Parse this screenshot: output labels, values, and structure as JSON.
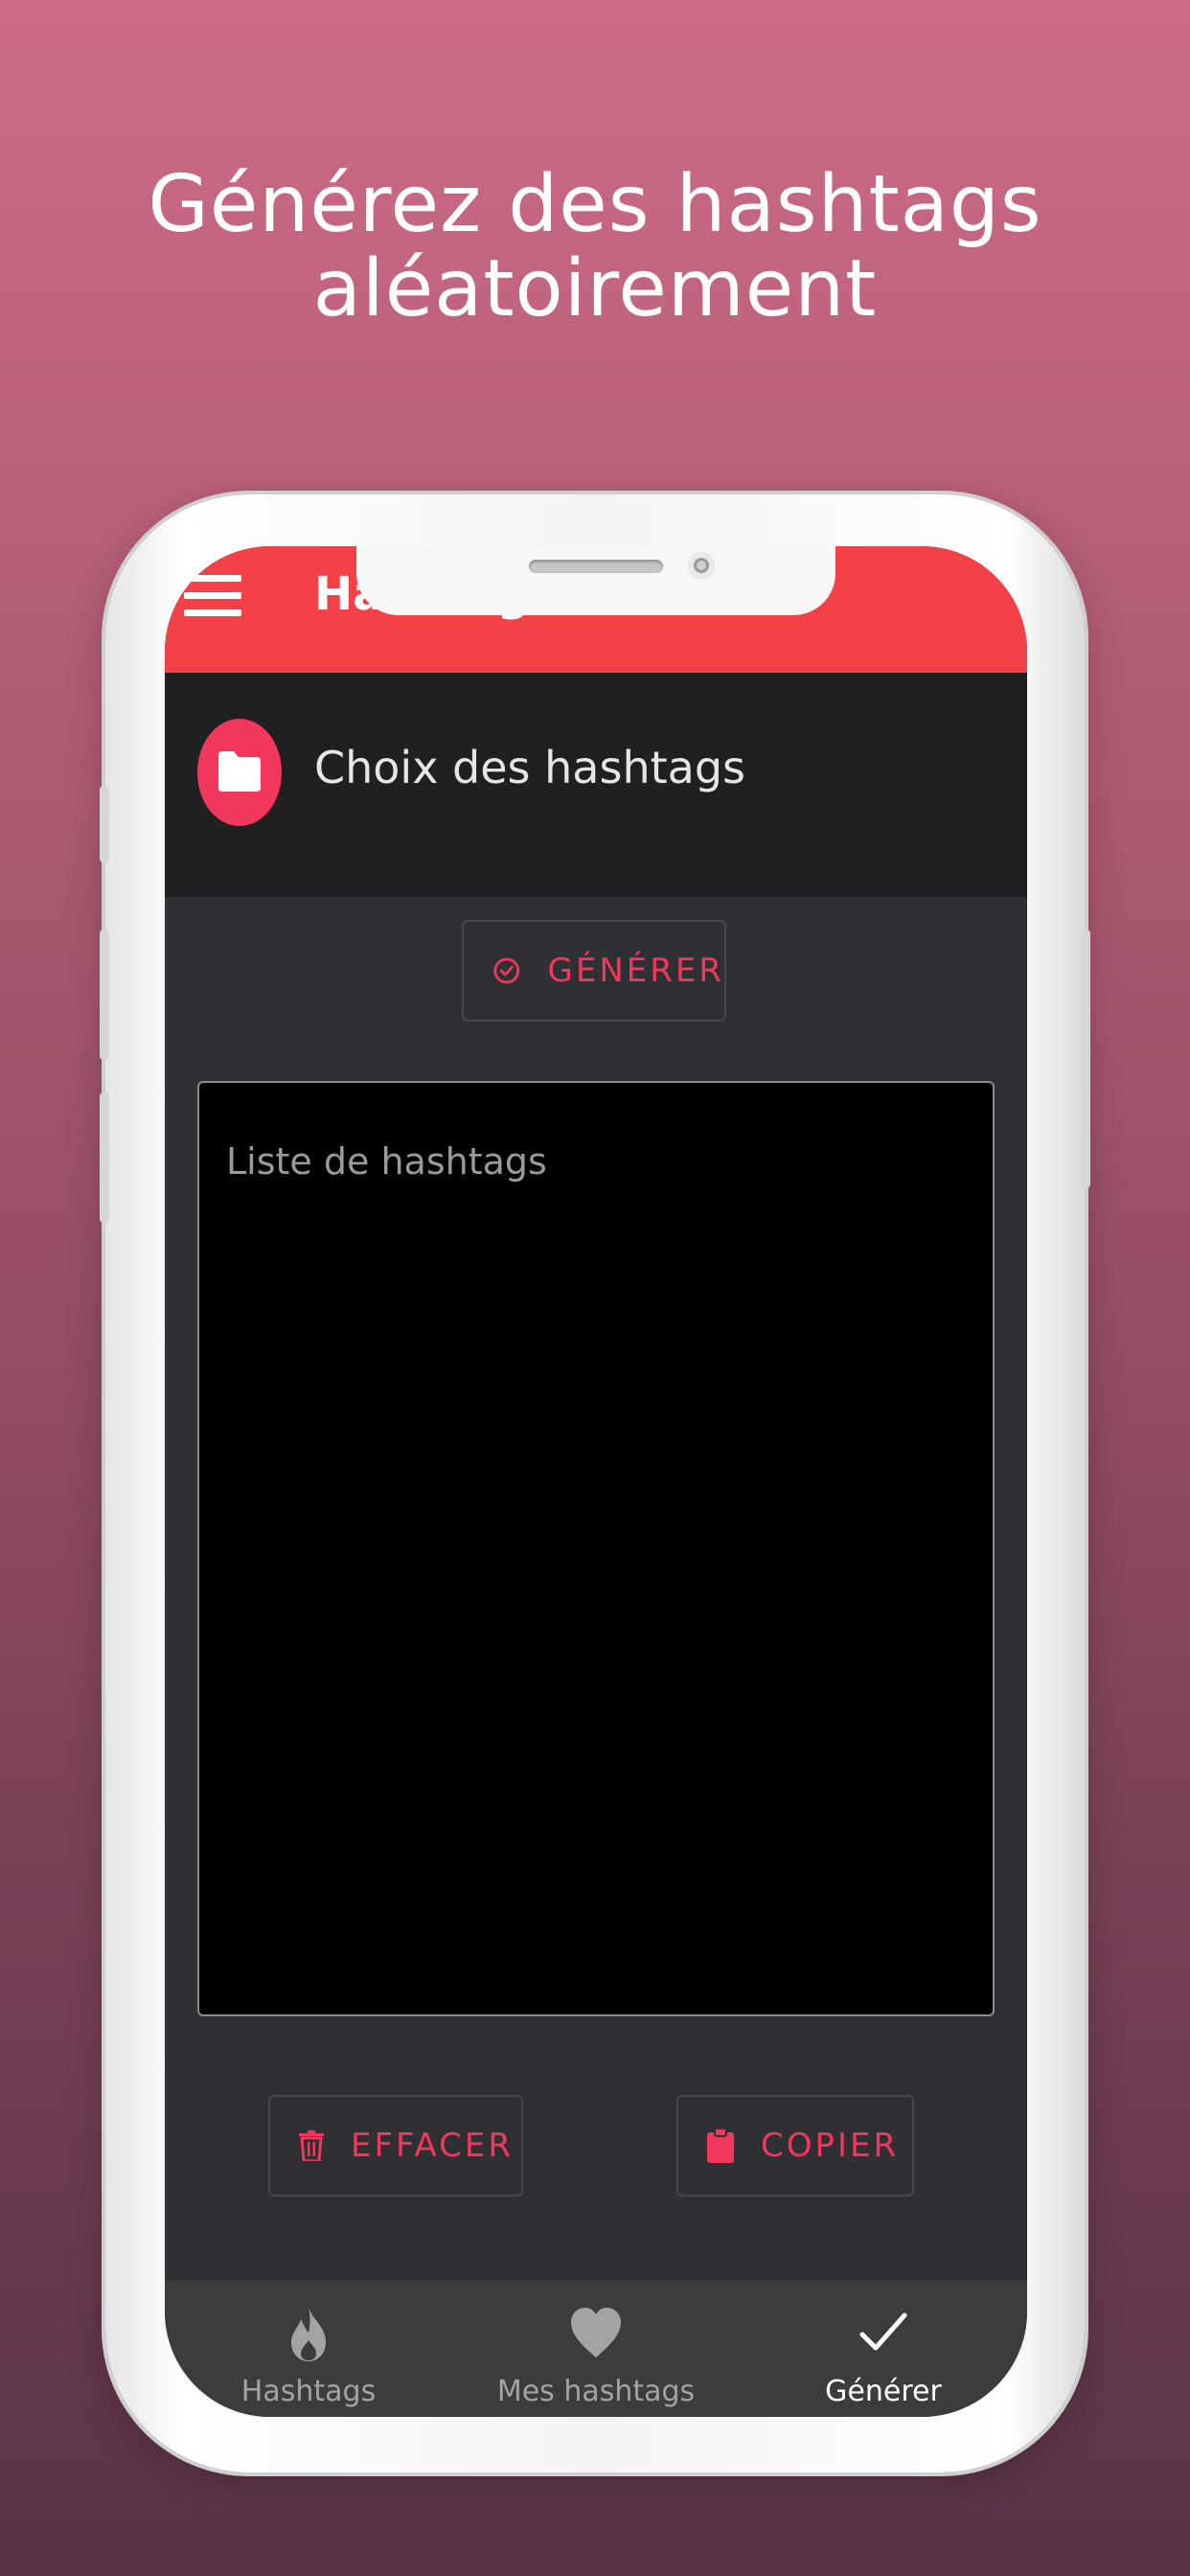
{
  "headline": {
    "line1": "Générez des hashtags",
    "line2": "aléatoirement"
  },
  "appbar": {
    "title": "Hashtags",
    "menu_icon": "hamburger-menu-icon"
  },
  "section": {
    "icon": "folder-icon",
    "title": "Choix des hashtags"
  },
  "actions": {
    "generate_label": "GÉNÉRER",
    "clear_label": "EFFACER",
    "copy_label": "COPIER"
  },
  "textarea": {
    "placeholder": "Liste de hashtags",
    "value": ""
  },
  "bottom_nav": {
    "items": [
      {
        "label": "Hashtags",
        "icon": "flame-icon",
        "active": false
      },
      {
        "label": "Mes hashtags",
        "icon": "heart-icon",
        "active": false
      },
      {
        "label": "Générer",
        "icon": "check-icon",
        "active": true
      }
    ]
  },
  "colors": {
    "accent": "#f2375c",
    "appbar": "#f44147",
    "background_top": "#cd6b87",
    "background_bottom": "#5a3347"
  }
}
